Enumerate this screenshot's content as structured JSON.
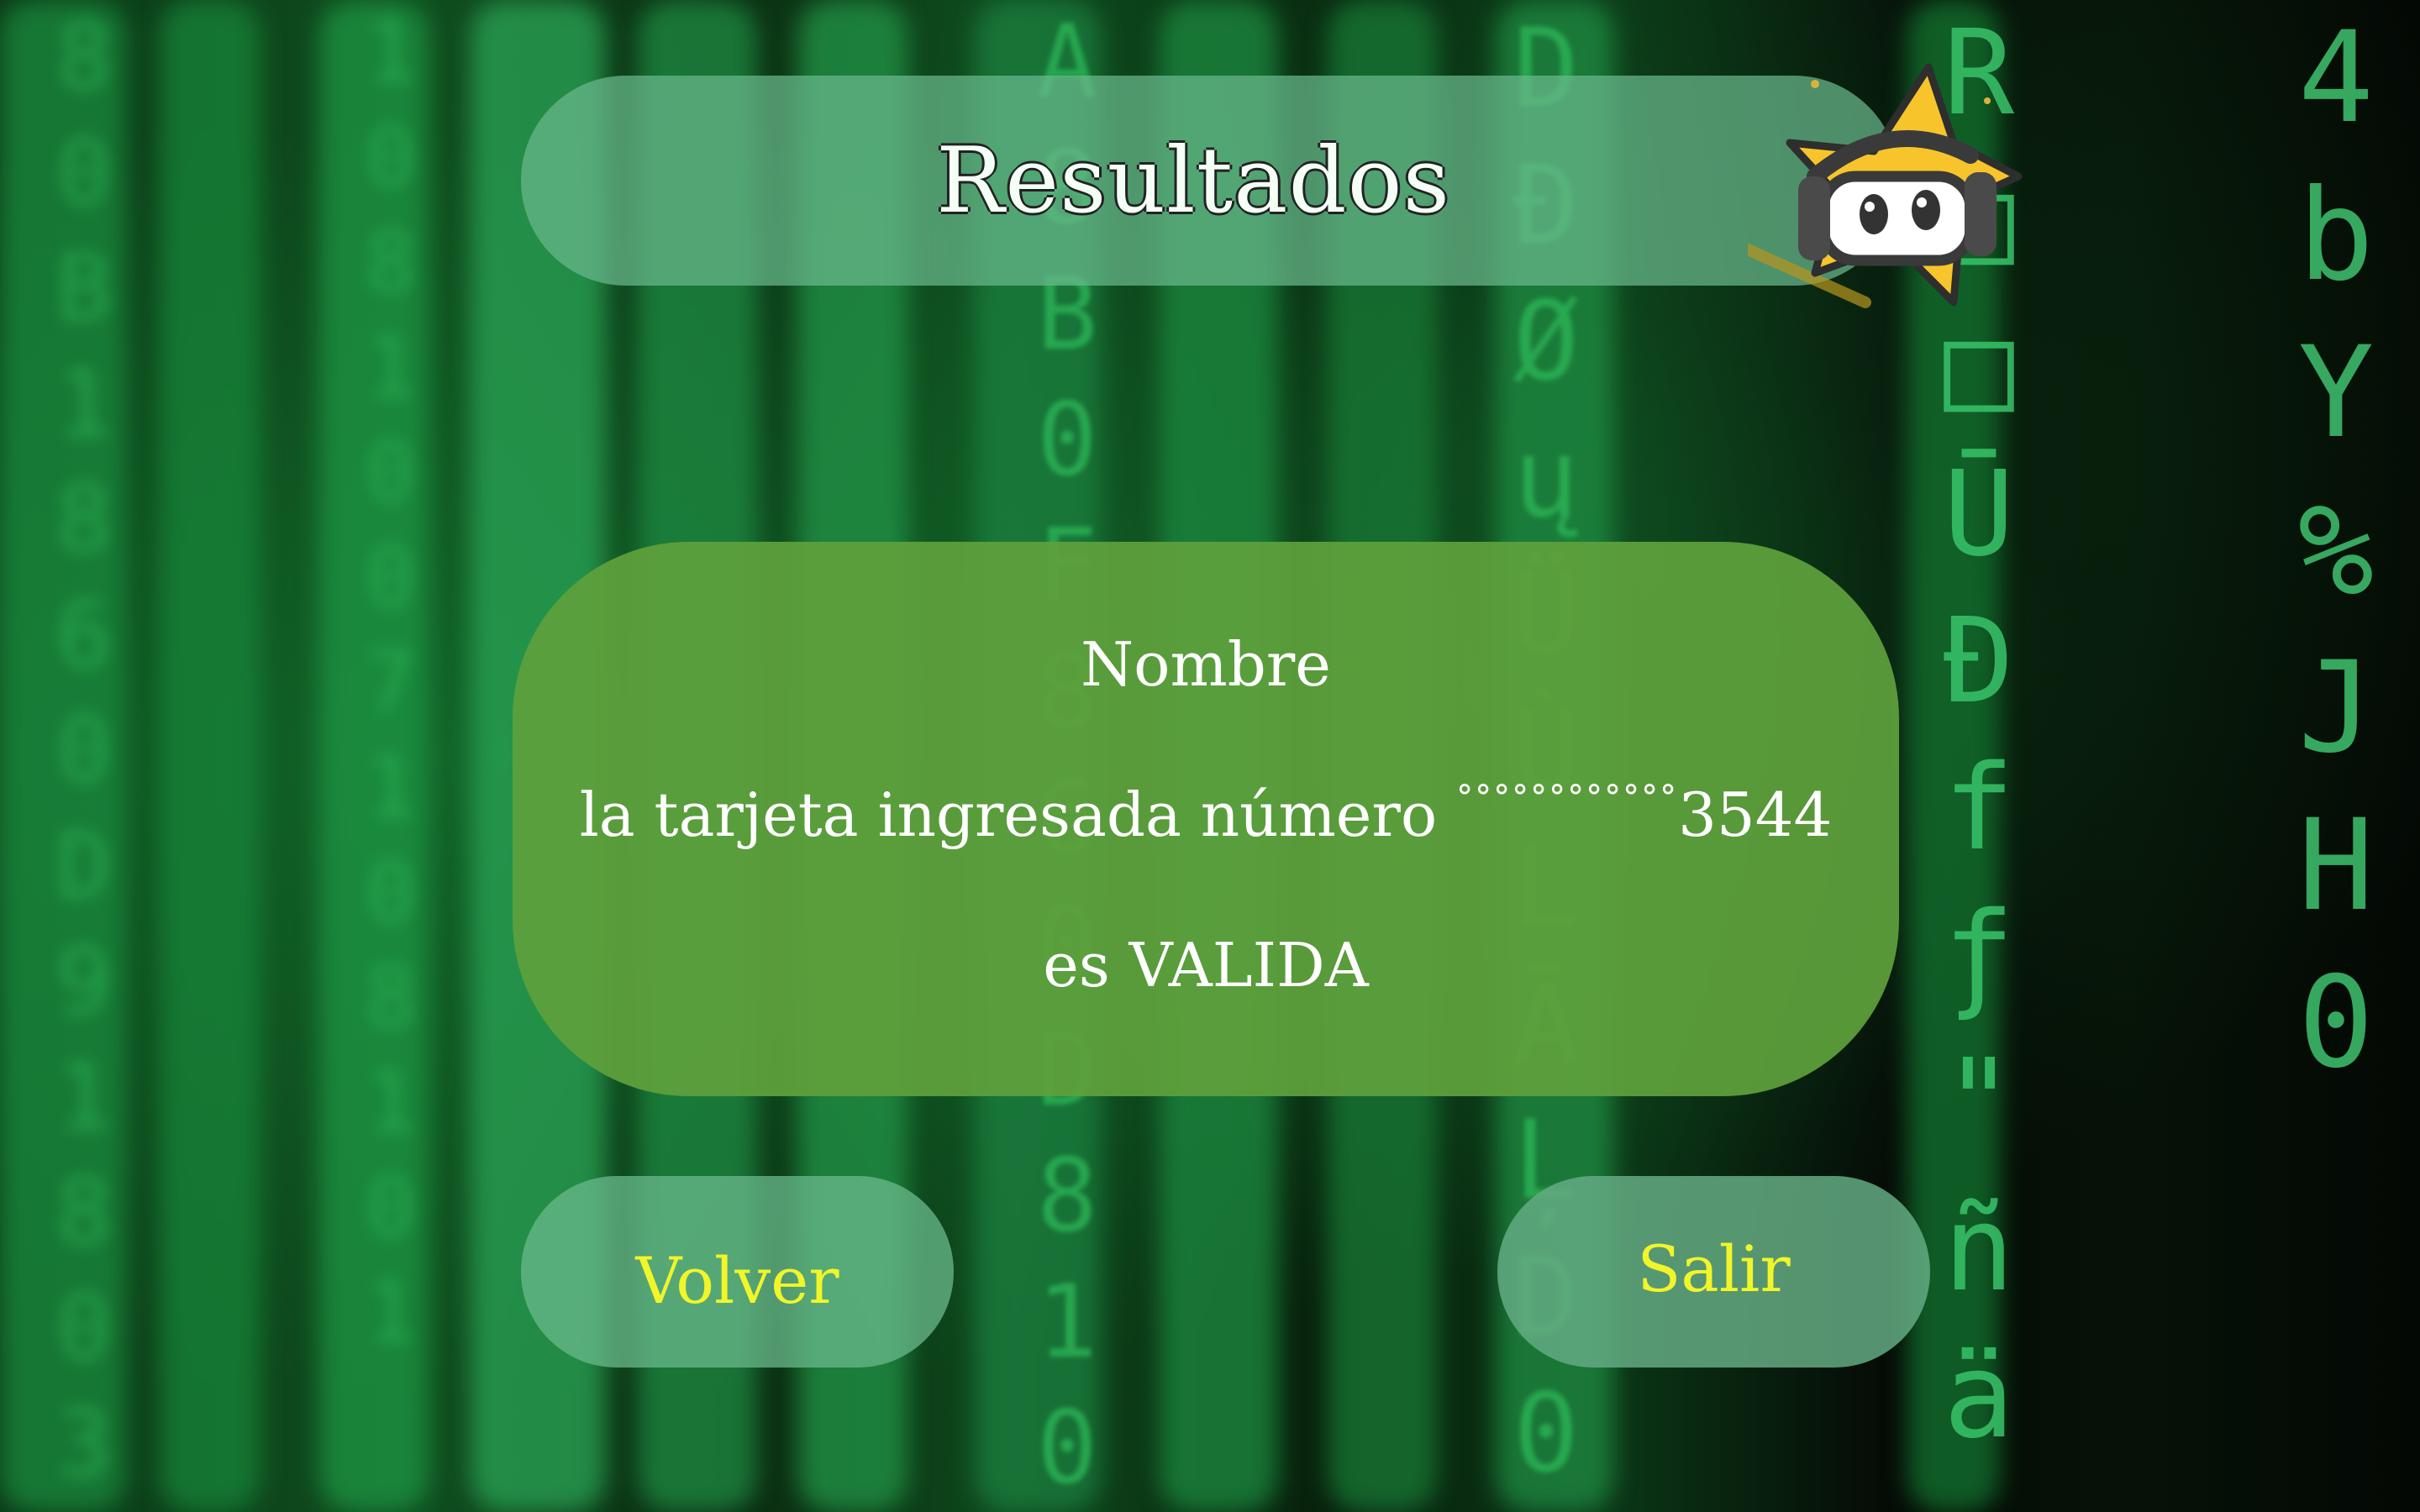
{
  "header": {
    "title": "Resultados"
  },
  "result": {
    "name": "Nombre",
    "card_prefix": "la tarjeta ingresada número ",
    "card_mask": "°°°°°°°°°°°°",
    "card_last_digits": "3544",
    "status_line": "es VALIDA"
  },
  "buttons": {
    "back_label": "Volver",
    "exit_label": "Salir"
  },
  "mascot": {
    "icon": "star-robot-mascot-icon"
  },
  "colors": {
    "header_bg": "#69b98c",
    "card_bg": "#5fa03c",
    "button_text": "#f1f52a",
    "mascot_star": "#f7c52b"
  }
}
